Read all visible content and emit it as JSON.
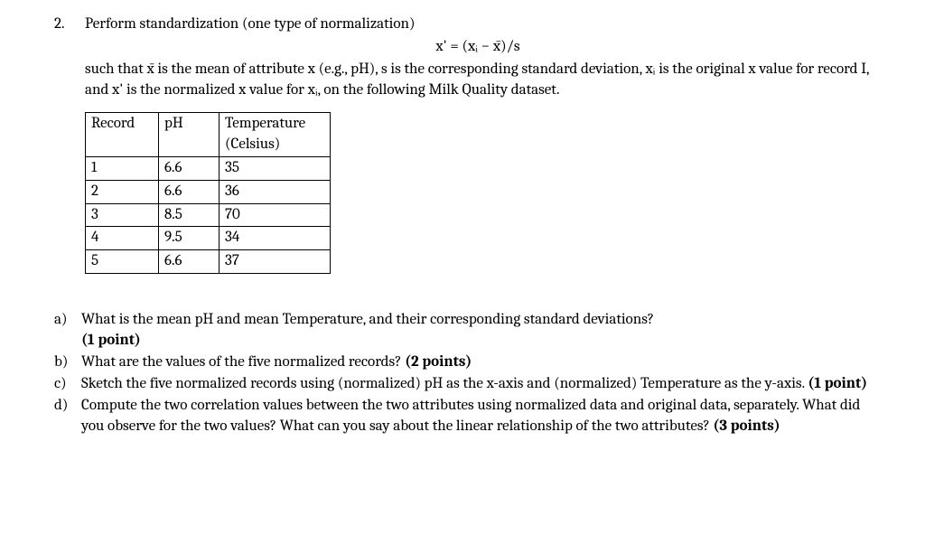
{
  "question": {
    "number": "2.",
    "intro_line1": "Perform standardization (one type of normalization)",
    "formula": "x' = (xᵢ − x̄)/s",
    "intro_line2": "such that x̄ is the mean of attribute x (e.g., pH), s is the corresponding standard deviation, xᵢ is the original x value for record I, and x' is the normalized x value for xᵢ, on the following Milk Quality dataset."
  },
  "table": {
    "headers": {
      "record": "Record",
      "ph": "pH",
      "temp_line1": "Temperature",
      "temp_line2": "(Celsius)"
    },
    "rows": [
      {
        "record": "1",
        "ph": "6.6",
        "temp": "35"
      },
      {
        "record": "2",
        "ph": "6.6",
        "temp": "36"
      },
      {
        "record": "3",
        "ph": "8.5",
        "temp": "70"
      },
      {
        "record": "4",
        "ph": "9.5",
        "temp": "34"
      },
      {
        "record": "5",
        "ph": "6.6",
        "temp": "37"
      }
    ]
  },
  "subquestions": {
    "a": {
      "label": "a)",
      "text": "What is the mean pH and mean Temperature, and their corresponding standard deviations?",
      "points": "(1 point)"
    },
    "b": {
      "label": "b)",
      "text": "What are the values of the five normalized records? ",
      "points": "(2 points)"
    },
    "c": {
      "label": "c)",
      "text": "Sketch the five normalized records using (normalized) pH as the x-axis and (normalized) Temperature as the y-axis. ",
      "points": "(1 point)"
    },
    "d": {
      "label": "d)",
      "text": "Compute the two correlation values between the two attributes using normalized data and original data, separately. What did you observe for the two values? What can you say about the linear relationship of the two attributes? ",
      "points": "(3 points)"
    }
  }
}
